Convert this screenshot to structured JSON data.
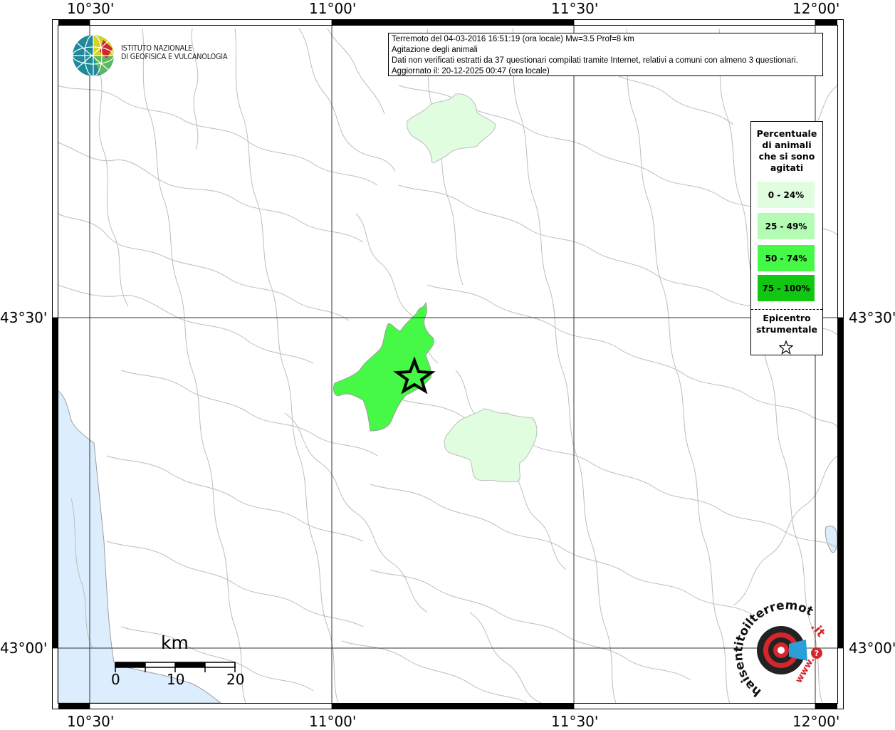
{
  "map": {
    "info": {
      "line1": "Terremoto del 04-03-2016 16:51:19 (ora locale) Mw=3.5 Prof=8 km",
      "line2": "Agitazione degli animali",
      "line3": "Dati non verificati estratti da 37 questionari compilati tramite Internet, relativi a comuni con almeno 3 questionari.",
      "line4": "Aggiornato il: 20-12-2025 00:47 (ora locale)"
    },
    "logo": {
      "line1": "ISTITUTO NAZIONALE",
      "line2": "DI GEOFISICA E VULCANOLOGIA"
    },
    "coords": {
      "lon_1030": "10°30'",
      "lon_1100": "11°00'",
      "lon_1130": "11°30'",
      "lon_1200": "12°00'",
      "lat_4330": "43°30'",
      "lat_4300": "43°00'"
    },
    "legend": {
      "title": [
        "Percentuale",
        "di animali",
        "che si sono",
        "agitati"
      ],
      "classes": [
        {
          "label": "0 - 24%",
          "color": "#e0fde0"
        },
        {
          "label": "25 - 49%",
          "color": "#b4fcb4"
        },
        {
          "label": "50 - 74%",
          "color": "#47f947"
        },
        {
          "label": "75 - 100%",
          "color": "#11c711"
        }
      ],
      "epicenter": [
        "Epicentro",
        "strumentale"
      ],
      "epicenter_icon": "star-icon"
    },
    "scale": {
      "unit": "km",
      "ticks": [
        "0",
        "10",
        "20"
      ]
    },
    "watermark": {
      "text1": "haisentitoilterremoto",
      "text2": ".it",
      "text3": "www.",
      "text4": "?"
    },
    "colors": {
      "sea": "#dceefd",
      "boundary": "#bdbdbd",
      "grid": "#333333"
    }
  }
}
